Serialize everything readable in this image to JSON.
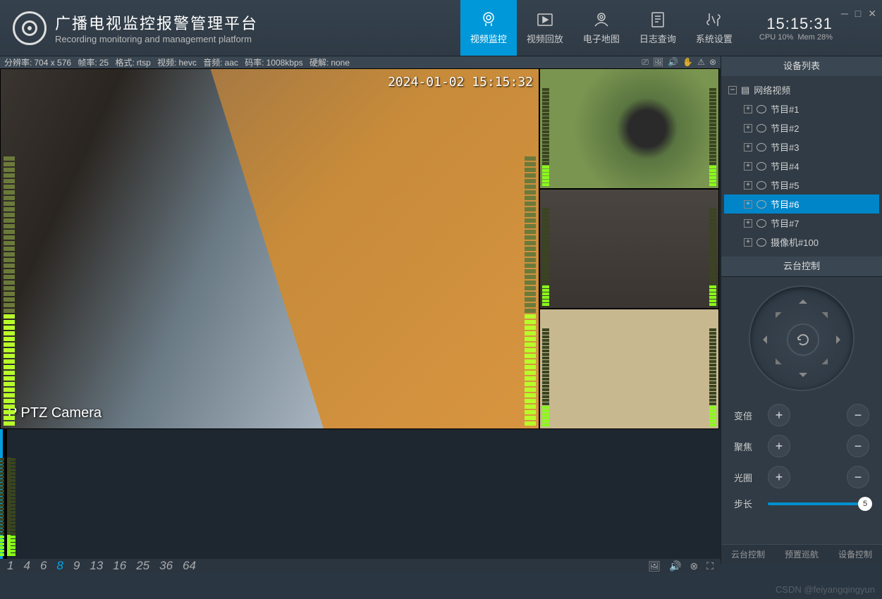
{
  "header": {
    "title_cn": "广播电视监控报警管理平台",
    "title_en": "Recording monitoring and management platform",
    "clock": "15:15:31",
    "cpu": "CPU 10%",
    "mem": "Mem 28%",
    "nav": [
      {
        "label": "视频监控"
      },
      {
        "label": "视频回放"
      },
      {
        "label": "电子地图"
      },
      {
        "label": "日志查询"
      },
      {
        "label": "系统设置"
      }
    ]
  },
  "infobar": {
    "res_label": "分辨率:",
    "res_val": "704 x 576",
    "fps_label": "帧率:",
    "fps_val": "25",
    "fmt_label": "格式:",
    "fmt_val": "rtsp",
    "vid_label": "视频:",
    "vid_val": "hevc",
    "aud_label": "音频:",
    "aud_val": "aac",
    "br_label": "码率:",
    "br_val": "1008kbps",
    "hw_label": "硬解:",
    "hw_val": "none"
  },
  "main_view": {
    "timestamp": "2024-01-02 15:15:32",
    "label": "P PTZ Camera"
  },
  "layouts": [
    "1",
    "4",
    "6",
    "8",
    "9",
    "13",
    "16",
    "25",
    "36",
    "64"
  ],
  "active_layout": "8",
  "sidebar": {
    "title": "设备列表",
    "root": "网络视频",
    "items": [
      {
        "label": "节目#1"
      },
      {
        "label": "节目#2"
      },
      {
        "label": "节目#3"
      },
      {
        "label": "节目#4"
      },
      {
        "label": "节目#5"
      },
      {
        "label": "节目#6"
      },
      {
        "label": "节目#7"
      },
      {
        "label": "摄像机#100"
      }
    ],
    "selected": "节目#6"
  },
  "ptz": {
    "title": "云台控制",
    "zoom": "变倍",
    "focus": "聚焦",
    "iris": "光圈",
    "step": "步长",
    "step_val": "5",
    "tabs": [
      "云台控制",
      "预置巡航",
      "设备控制"
    ]
  },
  "watermark": "CSDN @feiyangqingyun"
}
